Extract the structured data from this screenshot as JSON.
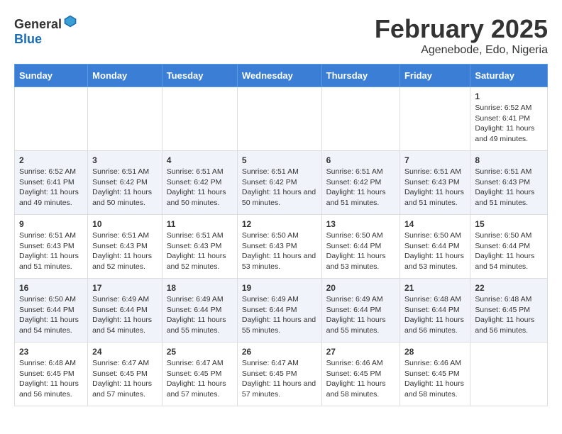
{
  "header": {
    "logo_general": "General",
    "logo_blue": "Blue",
    "title": "February 2025",
    "subtitle": "Agenebode, Edo, Nigeria"
  },
  "weekdays": [
    "Sunday",
    "Monday",
    "Tuesday",
    "Wednesday",
    "Thursday",
    "Friday",
    "Saturday"
  ],
  "weeks": [
    [
      {
        "day": "",
        "info": ""
      },
      {
        "day": "",
        "info": ""
      },
      {
        "day": "",
        "info": ""
      },
      {
        "day": "",
        "info": ""
      },
      {
        "day": "",
        "info": ""
      },
      {
        "day": "",
        "info": ""
      },
      {
        "day": "1",
        "info": "Sunrise: 6:52 AM\nSunset: 6:41 PM\nDaylight: 11 hours and 49 minutes."
      }
    ],
    [
      {
        "day": "2",
        "info": "Sunrise: 6:52 AM\nSunset: 6:41 PM\nDaylight: 11 hours and 49 minutes."
      },
      {
        "day": "3",
        "info": "Sunrise: 6:51 AM\nSunset: 6:42 PM\nDaylight: 11 hours and 50 minutes."
      },
      {
        "day": "4",
        "info": "Sunrise: 6:51 AM\nSunset: 6:42 PM\nDaylight: 11 hours and 50 minutes."
      },
      {
        "day": "5",
        "info": "Sunrise: 6:51 AM\nSunset: 6:42 PM\nDaylight: 11 hours and 50 minutes."
      },
      {
        "day": "6",
        "info": "Sunrise: 6:51 AM\nSunset: 6:42 PM\nDaylight: 11 hours and 51 minutes."
      },
      {
        "day": "7",
        "info": "Sunrise: 6:51 AM\nSunset: 6:43 PM\nDaylight: 11 hours and 51 minutes."
      },
      {
        "day": "8",
        "info": "Sunrise: 6:51 AM\nSunset: 6:43 PM\nDaylight: 11 hours and 51 minutes."
      }
    ],
    [
      {
        "day": "9",
        "info": "Sunrise: 6:51 AM\nSunset: 6:43 PM\nDaylight: 11 hours and 51 minutes."
      },
      {
        "day": "10",
        "info": "Sunrise: 6:51 AM\nSunset: 6:43 PM\nDaylight: 11 hours and 52 minutes."
      },
      {
        "day": "11",
        "info": "Sunrise: 6:51 AM\nSunset: 6:43 PM\nDaylight: 11 hours and 52 minutes."
      },
      {
        "day": "12",
        "info": "Sunrise: 6:50 AM\nSunset: 6:43 PM\nDaylight: 11 hours and 53 minutes."
      },
      {
        "day": "13",
        "info": "Sunrise: 6:50 AM\nSunset: 6:44 PM\nDaylight: 11 hours and 53 minutes."
      },
      {
        "day": "14",
        "info": "Sunrise: 6:50 AM\nSunset: 6:44 PM\nDaylight: 11 hours and 53 minutes."
      },
      {
        "day": "15",
        "info": "Sunrise: 6:50 AM\nSunset: 6:44 PM\nDaylight: 11 hours and 54 minutes."
      }
    ],
    [
      {
        "day": "16",
        "info": "Sunrise: 6:50 AM\nSunset: 6:44 PM\nDaylight: 11 hours and 54 minutes."
      },
      {
        "day": "17",
        "info": "Sunrise: 6:49 AM\nSunset: 6:44 PM\nDaylight: 11 hours and 54 minutes."
      },
      {
        "day": "18",
        "info": "Sunrise: 6:49 AM\nSunset: 6:44 PM\nDaylight: 11 hours and 55 minutes."
      },
      {
        "day": "19",
        "info": "Sunrise: 6:49 AM\nSunset: 6:44 PM\nDaylight: 11 hours and 55 minutes."
      },
      {
        "day": "20",
        "info": "Sunrise: 6:49 AM\nSunset: 6:44 PM\nDaylight: 11 hours and 55 minutes."
      },
      {
        "day": "21",
        "info": "Sunrise: 6:48 AM\nSunset: 6:44 PM\nDaylight: 11 hours and 56 minutes."
      },
      {
        "day": "22",
        "info": "Sunrise: 6:48 AM\nSunset: 6:45 PM\nDaylight: 11 hours and 56 minutes."
      }
    ],
    [
      {
        "day": "23",
        "info": "Sunrise: 6:48 AM\nSunset: 6:45 PM\nDaylight: 11 hours and 56 minutes."
      },
      {
        "day": "24",
        "info": "Sunrise: 6:47 AM\nSunset: 6:45 PM\nDaylight: 11 hours and 57 minutes."
      },
      {
        "day": "25",
        "info": "Sunrise: 6:47 AM\nSunset: 6:45 PM\nDaylight: 11 hours and 57 minutes."
      },
      {
        "day": "26",
        "info": "Sunrise: 6:47 AM\nSunset: 6:45 PM\nDaylight: 11 hours and 57 minutes."
      },
      {
        "day": "27",
        "info": "Sunrise: 6:46 AM\nSunset: 6:45 PM\nDaylight: 11 hours and 58 minutes."
      },
      {
        "day": "28",
        "info": "Sunrise: 6:46 AM\nSunset: 6:45 PM\nDaylight: 11 hours and 58 minutes."
      },
      {
        "day": "",
        "info": ""
      }
    ]
  ]
}
